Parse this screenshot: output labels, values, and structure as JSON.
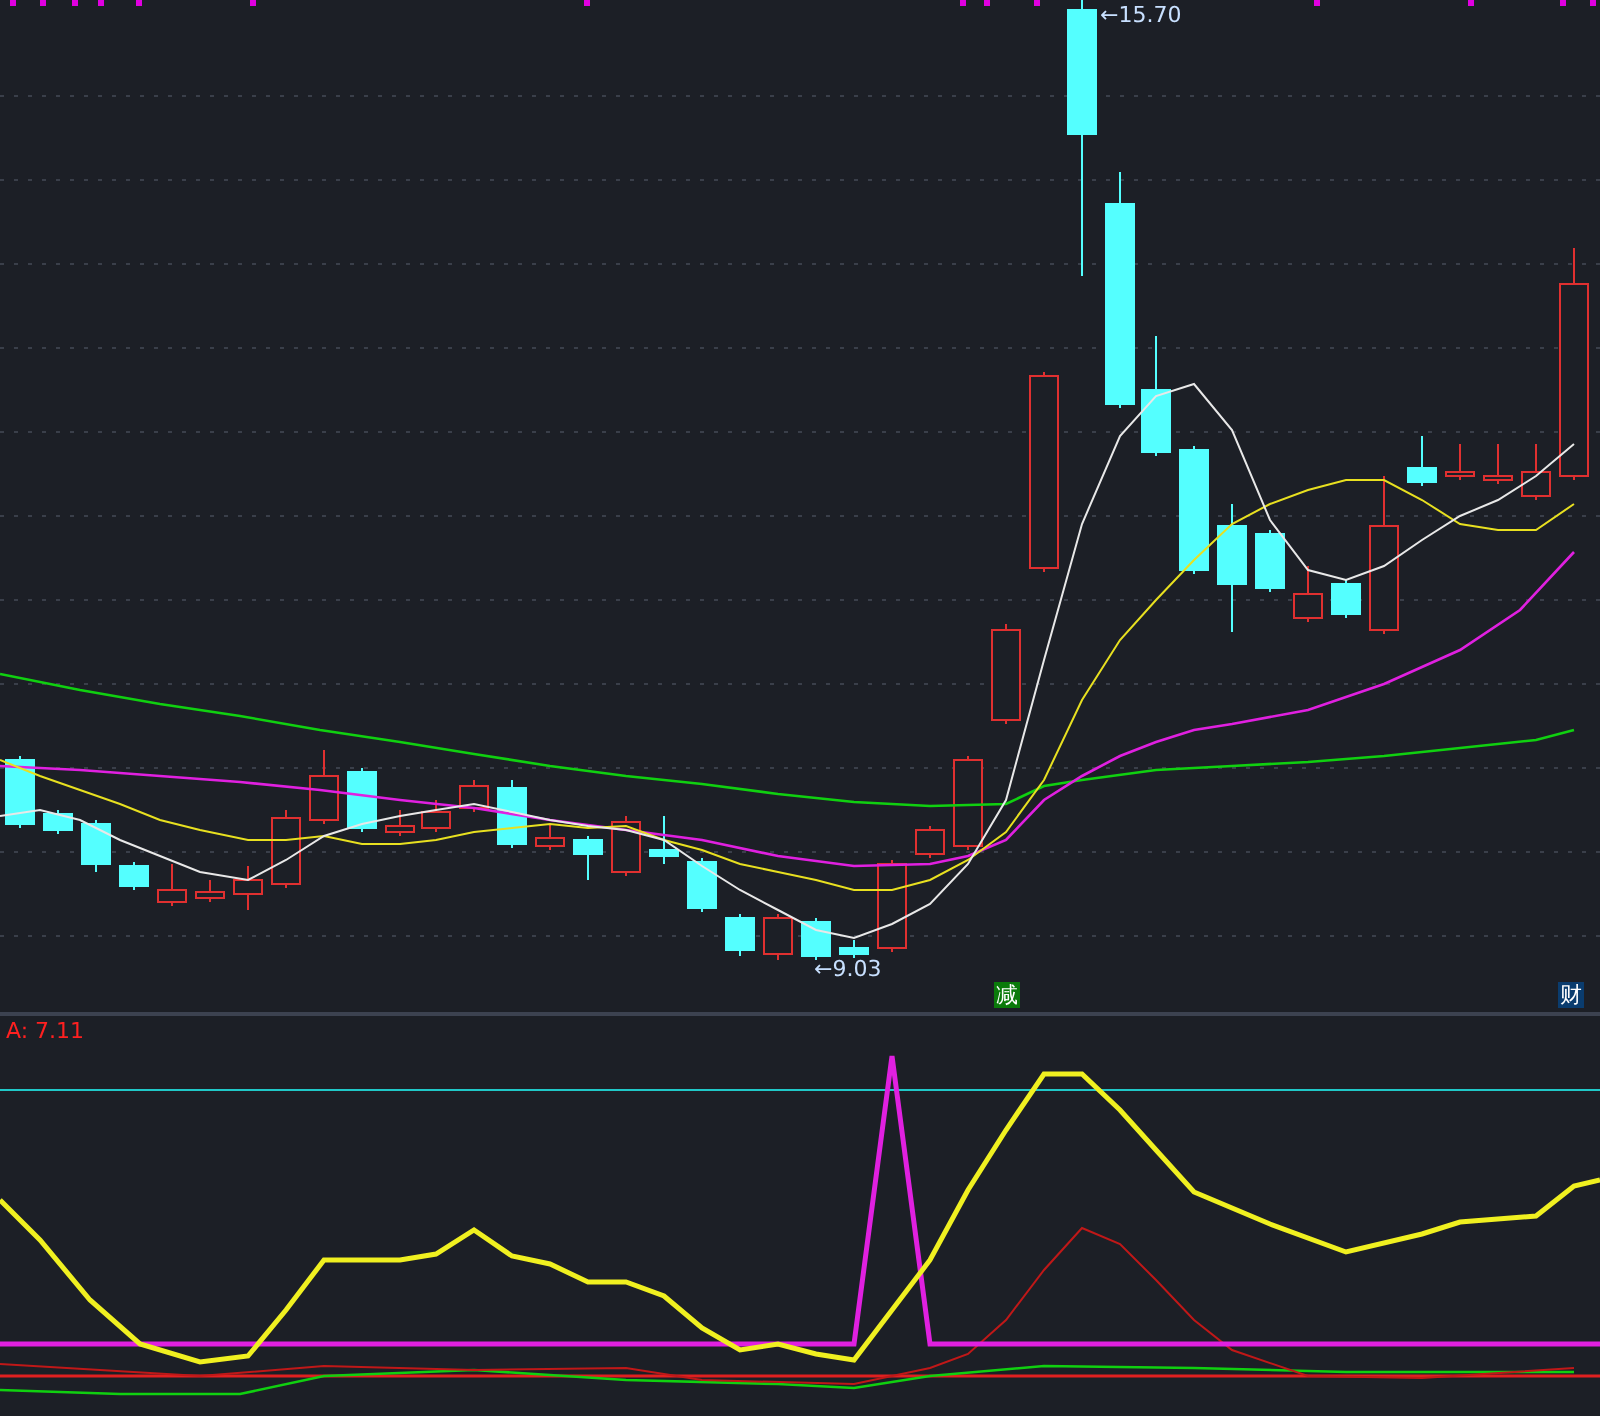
{
  "price_chart": {
    "high_label": "←15.70",
    "low_label": "←9.03",
    "badges": [
      {
        "label": "减",
        "kind": "reduce"
      },
      {
        "label": "财",
        "kind": "finance"
      }
    ]
  },
  "indicator_panel": {
    "legend": "A: 7.11"
  }
}
